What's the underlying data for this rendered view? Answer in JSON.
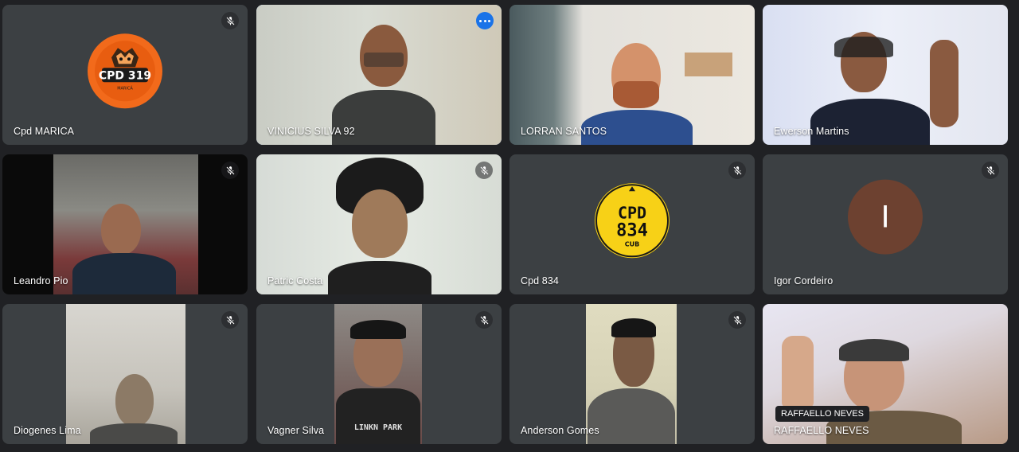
{
  "participants": [
    {
      "name": "Cpd MARICA",
      "muted": true,
      "type": "logo",
      "logo_text": "CPD 319",
      "logo_sub": "MARICÁ"
    },
    {
      "name": "VINICIUS SILVA 92",
      "muted": false,
      "type": "video",
      "speaking": true
    },
    {
      "name": "LORRAN SANTOS",
      "muted": false,
      "type": "video"
    },
    {
      "name": "Ewerson Martins",
      "muted": false,
      "type": "video"
    },
    {
      "name": "Leandro Pio",
      "muted": true,
      "type": "video"
    },
    {
      "name": "Patric Costa",
      "muted": true,
      "type": "video"
    },
    {
      "name": "Cpd 834",
      "muted": true,
      "type": "logo",
      "logo_text_1": "CPD",
      "logo_text_2": "834",
      "logo_sub": "CUB"
    },
    {
      "name": "Igor Cordeiro",
      "muted": true,
      "type": "avatar",
      "initial": "I"
    },
    {
      "name": "Diogenes Lima",
      "muted": true,
      "type": "video"
    },
    {
      "name": "Vagner Silva",
      "muted": true,
      "type": "video",
      "shirt_text": "LINKN PARK"
    },
    {
      "name": "Anderson Gomes",
      "muted": true,
      "type": "video"
    },
    {
      "name": "RAFFAELLO NEVES",
      "muted": false,
      "type": "video",
      "tooltip": "RAFFAELLO NEVES"
    }
  ],
  "icons": {
    "mic_off": "mic-off-icon",
    "more": "more-options-icon"
  },
  "colors": {
    "background": "#202124",
    "tile": "#3c4043",
    "speaking_border": "#8ab4f8",
    "more_button": "#1a73e8",
    "avatar_igor": "#6d4130",
    "logo_cpd319": "#f26a1b",
    "logo_cpd834": "#f7d117"
  }
}
